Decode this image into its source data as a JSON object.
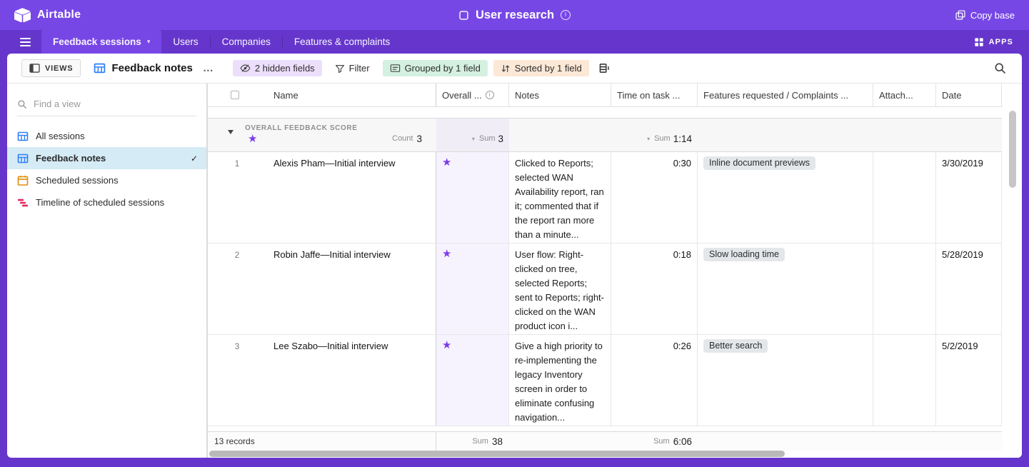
{
  "colors": {
    "topbar": "#7747e6",
    "frame": "#6636cc",
    "accent_star": "#7c3bec",
    "selected_view_bg": "#d5ebf5",
    "grid_view_icon": "#2d7ff9",
    "calendar_view_icon": "#e08c0b",
    "timeline_view_icon": "#e0295f",
    "hidden_pill_bg": "#ecdffc",
    "group_pill_bg": "#d4f0e0",
    "sort_pill_bg": "#fce8d6",
    "tag_bg": "#e4e7ea",
    "overall_col_bg": "#f7f3fe"
  },
  "glyphs": {
    "chevron_down": "▾",
    "ellipsis": "…",
    "check": "✓",
    "info": "i",
    "star": "★"
  },
  "topbar": {
    "app_name": "Airtable",
    "base_title": "User research",
    "copy_base": "Copy base"
  },
  "tabbar": {
    "tabs": [
      "Feedback sessions",
      "Users",
      "Companies",
      "Features & complaints"
    ],
    "active_tab": "Feedback sessions",
    "apps": "APPS"
  },
  "toolbar": {
    "views": "VIEWS",
    "view_name": "Feedback notes",
    "hidden_fields": "2 hidden fields",
    "filter": "Filter",
    "grouped": "Grouped by 1 field",
    "sorted": "Sorted by 1 field"
  },
  "sidebar": {
    "find_placeholder": "Find a view",
    "views": [
      {
        "label": "All sessions",
        "icon": "grid-view-icon",
        "selected": false
      },
      {
        "label": "Feedback notes",
        "icon": "grid-view-icon",
        "selected": true
      },
      {
        "label": "Scheduled sessions",
        "icon": "calendar-view-icon",
        "selected": false
      },
      {
        "label": "Timeline of scheduled sessions",
        "icon": "timeline-view-icon",
        "selected": false
      }
    ]
  },
  "table": {
    "columns": [
      "Name",
      "Overall ...",
      "Notes",
      "Time on task ...",
      "Features requested / Complaints ...",
      "Attach...",
      "Date"
    ],
    "group": {
      "field_label": "OVERALL FEEDBACK SCORE",
      "group_value_star": "★",
      "count_label": "Count",
      "count_value": "3",
      "overall_sum_label": "Sum",
      "overall_sum_value": "3",
      "time_sum_label": "Sum",
      "time_sum_value": "1:14"
    },
    "rows": [
      {
        "num": "1",
        "name": "Alexis Pham—Initial interview",
        "overall": "★",
        "notes": "Clicked to Reports; selected WAN Availability report, ran it; commented that if the report ran more than a minute...",
        "time": "0:30",
        "feature": "Inline document previews",
        "date": "3/30/2019"
      },
      {
        "num": "2",
        "name": "Robin Jaffe—Initial interview",
        "overall": "★",
        "notes": "User flow: Right-clicked on tree, selected Reports; sent to Reports; right-clicked on the WAN product icon i...",
        "time": "0:18",
        "feature": "Slow loading time",
        "date": "5/28/2019"
      },
      {
        "num": "3",
        "name": "Lee Szabo—Initial interview",
        "overall": "★",
        "notes": "Give a high priority to re-implementing the legacy Inventory screen in order to eliminate confusing navigation...",
        "time": "0:26",
        "feature": "Better search",
        "date": "5/2/2019"
      }
    ],
    "footer": {
      "records": "13 records",
      "overall_sum_label": "Sum",
      "overall_sum_value": "38",
      "time_sum_label": "Sum",
      "time_sum_value": "6:06"
    }
  }
}
